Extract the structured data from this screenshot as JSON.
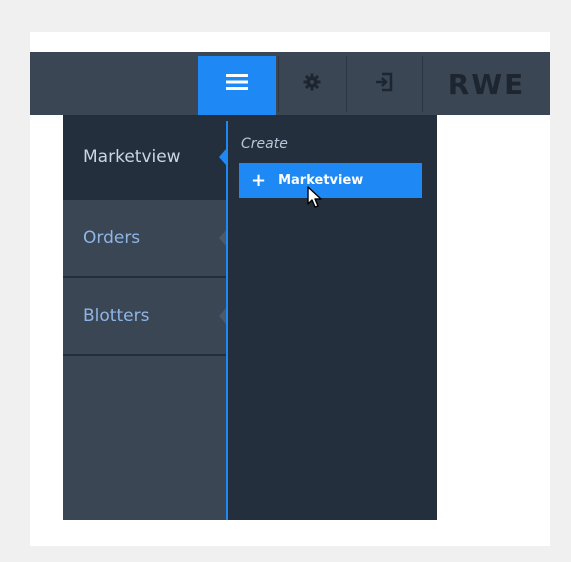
{
  "header": {
    "menu_icon": "hamburger-icon",
    "settings_icon": "gear-icon",
    "logout_icon": "logout-icon",
    "logo": "RWE"
  },
  "sidebar": {
    "items": [
      {
        "label": "Marketview",
        "active": true
      },
      {
        "label": "Orders",
        "active": false
      },
      {
        "label": "Blotters",
        "active": false
      }
    ]
  },
  "submenu": {
    "section_label": "Create",
    "create_button_label": "Marketview",
    "create_icon": "plus-icon"
  },
  "colors": {
    "accent": "#1e88f5",
    "header_bg": "#3a4653",
    "panel_bg": "#232f3d"
  }
}
